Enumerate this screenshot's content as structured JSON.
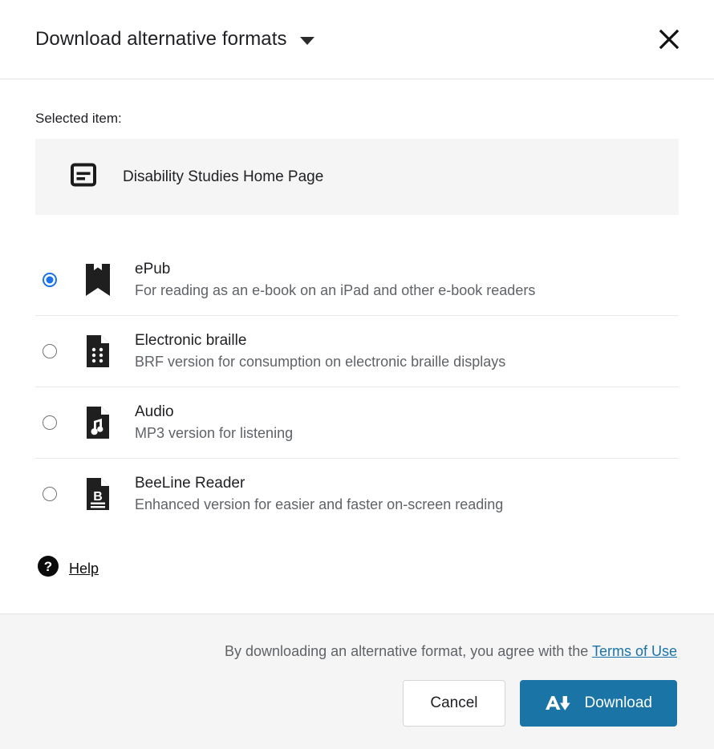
{
  "header": {
    "title": "Download alternative formats",
    "dropdown_icon": "chevron-down-icon",
    "close_icon": "close-icon"
  },
  "body": {
    "selected_label": "Selected item:",
    "selected_item": {
      "icon": "web-page-icon",
      "title": "Disability Studies Home Page"
    },
    "formats": [
      {
        "id": "epub",
        "icon": "book-icon",
        "name": "ePub",
        "description": "For reading as an e-book on an iPad and other e-book readers",
        "selected": true
      },
      {
        "id": "braille",
        "icon": "braille-document-icon",
        "name": "Electronic braille",
        "description": "BRF version for consumption on electronic braille displays",
        "selected": false
      },
      {
        "id": "audio",
        "icon": "audio-document-icon",
        "name": "Audio",
        "description": "MP3 version for listening",
        "selected": false
      },
      {
        "id": "beeline",
        "icon": "beeline-document-icon",
        "name": "BeeLine Reader",
        "description": "Enhanced version for easier and faster on-screen reading",
        "selected": false
      }
    ],
    "help": {
      "icon": "help-circle-icon",
      "label": "Help"
    }
  },
  "footer": {
    "terms_text": "By downloading an alternative format, you agree with the ",
    "terms_link": "Terms of Use",
    "cancel_label": "Cancel",
    "download_label": "Download",
    "download_icon": "text-download-icon"
  },
  "colors": {
    "accent_blue": "#1a73e8",
    "button_blue": "#1a74a6",
    "link_blue": "#1a73a8",
    "panel_grey": "#f5f5f5",
    "text_primary": "#202124",
    "text_secondary": "#5f6368"
  }
}
